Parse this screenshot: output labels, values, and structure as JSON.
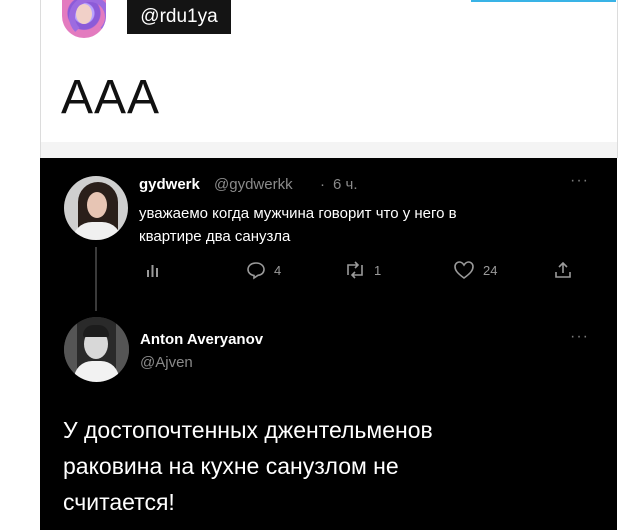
{
  "header": {
    "handle": "@rdu1ya",
    "post_text": "AAA"
  },
  "quoted_tweet": {
    "display_name": "gydwerk",
    "handle": "@gydwerkk",
    "separator": "·",
    "time": "6 ч.",
    "more": "···",
    "text_line1": "уважаемо когда мужчина говорит что у него в",
    "text_line2": "квартире два санузла",
    "actions": {
      "reply_count": "4",
      "retweet_count": "1",
      "like_count": "24"
    },
    "icons": [
      "analytics-icon",
      "reply-icon",
      "retweet-icon",
      "like-icon",
      "share-icon"
    ]
  },
  "reply_tweet": {
    "display_name": "Anton Averyanov",
    "handle": "@Ajven",
    "more": "···",
    "text_line1": "У достопочтенных джентельменов",
    "text_line2": "раковина на кухне санузлом не",
    "text_line3": "считается!"
  },
  "colors": {
    "dark_bg": "#000000",
    "accent": "#39b3e6",
    "muted": "#8a8a8a"
  }
}
